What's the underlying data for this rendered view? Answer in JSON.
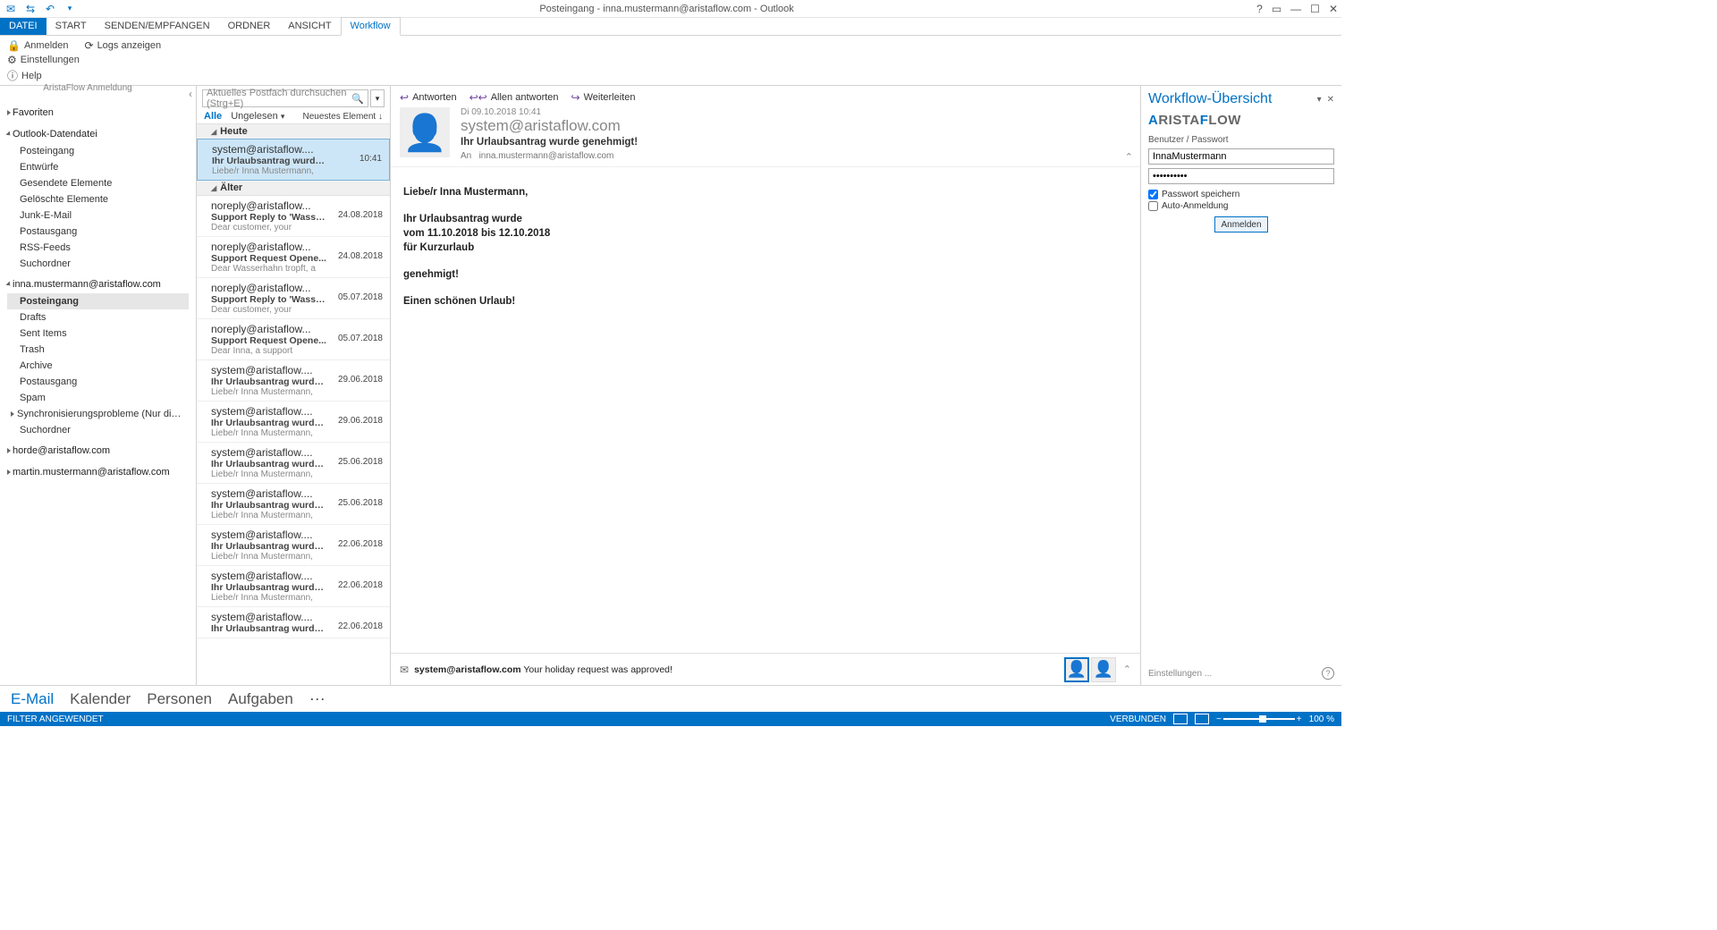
{
  "title": "Posteingang - inna.mustermann@aristaflow.com - Outlook",
  "ribbon": {
    "tabs": [
      "DATEI",
      "START",
      "SENDEN/EMPFANGEN",
      "ORDNER",
      "ANSICHT",
      "Workflow"
    ],
    "active": 5,
    "buttons": {
      "login": "Anmelden",
      "logs": "Logs anzeigen",
      "settings": "Einstellungen",
      "help": "Help"
    },
    "group": "AristaFlow Anmeldung"
  },
  "nav": {
    "favorites": "Favoriten",
    "datafile": "Outlook-Datendatei",
    "datafile_folders": [
      "Posteingang",
      "Entwürfe",
      "Gesendete Elemente",
      "Gelöschte Elemente",
      "Junk-E-Mail",
      "Postausgang",
      "RSS-Feeds",
      "Suchordner"
    ],
    "account1": "inna.mustermann@aristaflow.com",
    "account1_folders": [
      "Posteingang",
      "Drafts",
      "Sent Items",
      "Trash",
      "Archive",
      "Postausgang",
      "Spam",
      "Synchronisierungsprobleme (Nur dieser Co...",
      "Suchordner"
    ],
    "account2": "horde@aristaflow.com",
    "account3": "martin.mustermann@aristaflow.com",
    "selected": "Posteingang"
  },
  "list": {
    "search_placeholder": "Aktuelles Postfach durchsuchen (Strg+E)",
    "filter_all": "Alle",
    "filter_unread": "Ungelesen",
    "sort": "Neuestes Element ↓",
    "groups": {
      "today": "Heute",
      "older": "Älter"
    },
    "today_msgs": [
      {
        "from": "system@aristaflow....",
        "subj": "Ihr Urlaubsantrag wurde ...",
        "prev": "Liebe/r Inna Mustermann,",
        "date": "10:41"
      }
    ],
    "older_msgs": [
      {
        "from": "noreply@aristaflow...",
        "subj": "Support Reply to 'Wasser...",
        "prev": "Dear customer, your",
        "date": "24.08.2018"
      },
      {
        "from": "noreply@aristaflow...",
        "subj": "Support Request Opene...",
        "prev": "Dear Wasserhahn tropft, a",
        "date": "24.08.2018"
      },
      {
        "from": "noreply@aristaflow...",
        "subj": "Support Reply to 'Wasser...",
        "prev": "Dear customer, your",
        "date": "05.07.2018"
      },
      {
        "from": "noreply@aristaflow...",
        "subj": "Support Request Opene...",
        "prev": "Dear Inna, a support",
        "date": "05.07.2018"
      },
      {
        "from": "system@aristaflow....",
        "subj": "Ihr Urlaubsantrag wurde ...",
        "prev": "Liebe/r Inna Mustermann,",
        "date": "29.06.2018"
      },
      {
        "from": "system@aristaflow....",
        "subj": "Ihr Urlaubsantrag wurde ...",
        "prev": "Liebe/r Inna Mustermann,",
        "date": "29.06.2018"
      },
      {
        "from": "system@aristaflow....",
        "subj": "Ihr Urlaubsantrag wurde ...",
        "prev": "Liebe/r Inna Mustermann,",
        "date": "25.06.2018"
      },
      {
        "from": "system@aristaflow....",
        "subj": "Ihr Urlaubsantrag wurde ...",
        "prev": "Liebe/r Inna Mustermann,",
        "date": "25.06.2018"
      },
      {
        "from": "system@aristaflow....",
        "subj": "Ihr Urlaubsantrag wurde ...",
        "prev": "Liebe/r Inna Mustermann,",
        "date": "22.06.2018"
      },
      {
        "from": "system@aristaflow....",
        "subj": "Ihr Urlaubsantrag wurde ...",
        "prev": "Liebe/r Inna Mustermann,",
        "date": "22.06.2018"
      },
      {
        "from": "system@aristaflow....",
        "subj": "Ihr Urlaubsantrag wurde ...",
        "prev": "",
        "date": "22.06.2018"
      }
    ]
  },
  "reading": {
    "actions": {
      "reply": "Antworten",
      "replyall": "Allen antworten",
      "forward": "Weiterleiten"
    },
    "date": "Di 09.10.2018 10:41",
    "from": "system@aristaflow.com",
    "subject": "Ihr Urlaubsantrag wurde genehmigt!",
    "to_label": "An",
    "to": "inna.mustermann@aristaflow.com",
    "body": {
      "greet": "Liebe/r Inna Mustermann,",
      "l1": "Ihr Urlaubsantrag wurde",
      "l2": "vom 11.10.2018 bis 12.10.2018",
      "l3": "für Kurzurlaub",
      "l4": "genehmigt!",
      "l5": "Einen schönen Urlaub!"
    },
    "footer_from": "system@aristaflow.com",
    "footer_text": "Your holiday request was approved!"
  },
  "sidepanel": {
    "title": "Workflow-Übersicht",
    "logo_text": "ARISTAFLOW",
    "label": "Benutzer / Passwort",
    "user": "InnaMustermann",
    "pass": "••••••••••",
    "save": "Passwort speichern",
    "auto": "Auto-Anmeldung",
    "login": "Anmelden",
    "settings": "Einstellungen ..."
  },
  "modules": {
    "mail": "E-Mail",
    "cal": "Kalender",
    "people": "Personen",
    "tasks": "Aufgaben"
  },
  "status": {
    "filter": "FILTER ANGEWENDET",
    "conn": "VERBUNDEN",
    "zoom": "100 %"
  }
}
